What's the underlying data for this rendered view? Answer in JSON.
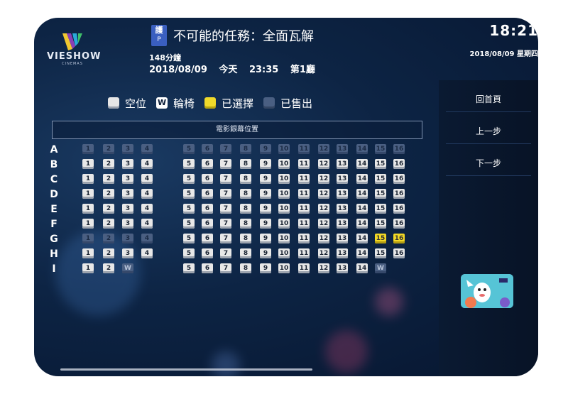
{
  "brand": {
    "name": "VIESHOW",
    "sub": "CINEMAS",
    "logo_icon": "vieshow-logo-icon"
  },
  "movie": {
    "rating_top": "護",
    "rating_bottom": "P",
    "title": "不可能的任務：全面瓦解",
    "runtime": "148分鐘",
    "date": "2018/08/09",
    "day": "今天",
    "time": "23:35",
    "hall": "第1廳"
  },
  "clock": {
    "time": "18:21",
    "date": "2018/08/09 星期四"
  },
  "legend": [
    {
      "label": "空位",
      "type": "empty"
    },
    {
      "label": "輪椅",
      "type": "wheel",
      "glyph": "W"
    },
    {
      "label": "已選擇",
      "type": "selected"
    },
    {
      "label": "已售出",
      "type": "sold"
    }
  ],
  "screen_label": "電影銀幕位置",
  "sidebar": {
    "home": "回首頁",
    "prev": "上一步",
    "next": "下一步"
  },
  "rows": [
    {
      "label": "A",
      "seats": [
        {
          "n": "1",
          "s": "sold"
        },
        {
          "n": "2",
          "s": "sold"
        },
        {
          "n": "3",
          "s": "sold"
        },
        {
          "n": "4",
          "s": "sold"
        },
        {
          "n": "5",
          "s": "sold"
        },
        {
          "n": "6",
          "s": "sold"
        },
        {
          "n": "7",
          "s": "sold"
        },
        {
          "n": "8",
          "s": "sold"
        },
        {
          "n": "9",
          "s": "sold"
        },
        {
          "n": "10",
          "s": "sold"
        },
        {
          "n": "11",
          "s": "sold"
        },
        {
          "n": "12",
          "s": "sold"
        },
        {
          "n": "13",
          "s": "sold"
        },
        {
          "n": "14",
          "s": "sold"
        },
        {
          "n": "15",
          "s": "sold"
        },
        {
          "n": "16",
          "s": "sold"
        }
      ]
    },
    {
      "label": "B",
      "seats": [
        {
          "n": "1",
          "s": "empty"
        },
        {
          "n": "2",
          "s": "empty"
        },
        {
          "n": "3",
          "s": "empty"
        },
        {
          "n": "4",
          "s": "empty"
        },
        {
          "n": "5",
          "s": "empty"
        },
        {
          "n": "6",
          "s": "empty"
        },
        {
          "n": "7",
          "s": "empty"
        },
        {
          "n": "8",
          "s": "empty"
        },
        {
          "n": "9",
          "s": "empty"
        },
        {
          "n": "10",
          "s": "empty"
        },
        {
          "n": "11",
          "s": "empty"
        },
        {
          "n": "12",
          "s": "empty"
        },
        {
          "n": "13",
          "s": "empty"
        },
        {
          "n": "14",
          "s": "empty"
        },
        {
          "n": "15",
          "s": "empty"
        },
        {
          "n": "16",
          "s": "empty"
        }
      ]
    },
    {
      "label": "C",
      "seats": [
        {
          "n": "1",
          "s": "empty"
        },
        {
          "n": "2",
          "s": "empty"
        },
        {
          "n": "3",
          "s": "empty"
        },
        {
          "n": "4",
          "s": "empty"
        },
        {
          "n": "5",
          "s": "empty"
        },
        {
          "n": "6",
          "s": "empty"
        },
        {
          "n": "7",
          "s": "empty"
        },
        {
          "n": "8",
          "s": "empty"
        },
        {
          "n": "9",
          "s": "empty"
        },
        {
          "n": "10",
          "s": "empty"
        },
        {
          "n": "11",
          "s": "empty"
        },
        {
          "n": "12",
          "s": "empty"
        },
        {
          "n": "13",
          "s": "empty"
        },
        {
          "n": "14",
          "s": "empty"
        },
        {
          "n": "15",
          "s": "empty"
        },
        {
          "n": "16",
          "s": "empty"
        }
      ]
    },
    {
      "label": "D",
      "seats": [
        {
          "n": "1",
          "s": "empty"
        },
        {
          "n": "2",
          "s": "empty"
        },
        {
          "n": "3",
          "s": "empty"
        },
        {
          "n": "4",
          "s": "empty"
        },
        {
          "n": "5",
          "s": "empty"
        },
        {
          "n": "6",
          "s": "empty"
        },
        {
          "n": "7",
          "s": "empty"
        },
        {
          "n": "8",
          "s": "empty"
        },
        {
          "n": "9",
          "s": "empty"
        },
        {
          "n": "10",
          "s": "empty"
        },
        {
          "n": "11",
          "s": "empty"
        },
        {
          "n": "12",
          "s": "empty"
        },
        {
          "n": "13",
          "s": "empty"
        },
        {
          "n": "14",
          "s": "empty"
        },
        {
          "n": "15",
          "s": "empty"
        },
        {
          "n": "16",
          "s": "empty"
        }
      ]
    },
    {
      "label": "E",
      "seats": [
        {
          "n": "1",
          "s": "empty"
        },
        {
          "n": "2",
          "s": "empty"
        },
        {
          "n": "3",
          "s": "empty"
        },
        {
          "n": "4",
          "s": "empty"
        },
        {
          "n": "5",
          "s": "empty"
        },
        {
          "n": "6",
          "s": "empty"
        },
        {
          "n": "7",
          "s": "empty"
        },
        {
          "n": "8",
          "s": "empty"
        },
        {
          "n": "9",
          "s": "empty"
        },
        {
          "n": "10",
          "s": "empty"
        },
        {
          "n": "11",
          "s": "empty"
        },
        {
          "n": "12",
          "s": "empty"
        },
        {
          "n": "13",
          "s": "empty"
        },
        {
          "n": "14",
          "s": "empty"
        },
        {
          "n": "15",
          "s": "empty"
        },
        {
          "n": "16",
          "s": "empty"
        }
      ]
    },
    {
      "label": "F",
      "seats": [
        {
          "n": "1",
          "s": "empty"
        },
        {
          "n": "2",
          "s": "empty"
        },
        {
          "n": "3",
          "s": "empty"
        },
        {
          "n": "4",
          "s": "empty"
        },
        {
          "n": "5",
          "s": "empty"
        },
        {
          "n": "6",
          "s": "empty"
        },
        {
          "n": "7",
          "s": "empty"
        },
        {
          "n": "8",
          "s": "empty"
        },
        {
          "n": "9",
          "s": "empty"
        },
        {
          "n": "10",
          "s": "empty"
        },
        {
          "n": "11",
          "s": "empty"
        },
        {
          "n": "12",
          "s": "empty"
        },
        {
          "n": "13",
          "s": "empty"
        },
        {
          "n": "14",
          "s": "empty"
        },
        {
          "n": "15",
          "s": "empty"
        },
        {
          "n": "16",
          "s": "empty"
        }
      ]
    },
    {
      "label": "G",
      "seats": [
        {
          "n": "1",
          "s": "sold"
        },
        {
          "n": "2",
          "s": "sold"
        },
        {
          "n": "3",
          "s": "sold"
        },
        {
          "n": "4",
          "s": "sold"
        },
        {
          "n": "5",
          "s": "empty"
        },
        {
          "n": "6",
          "s": "empty"
        },
        {
          "n": "7",
          "s": "empty"
        },
        {
          "n": "8",
          "s": "empty"
        },
        {
          "n": "9",
          "s": "empty"
        },
        {
          "n": "10",
          "s": "empty"
        },
        {
          "n": "11",
          "s": "empty"
        },
        {
          "n": "12",
          "s": "empty"
        },
        {
          "n": "13",
          "s": "empty"
        },
        {
          "n": "14",
          "s": "empty"
        },
        {
          "n": "15",
          "s": "selected"
        },
        {
          "n": "16",
          "s": "selected"
        }
      ]
    },
    {
      "label": "H",
      "seats": [
        {
          "n": "1",
          "s": "empty"
        },
        {
          "n": "2",
          "s": "empty"
        },
        {
          "n": "3",
          "s": "empty"
        },
        {
          "n": "4",
          "s": "empty"
        },
        {
          "n": "5",
          "s": "empty"
        },
        {
          "n": "6",
          "s": "empty"
        },
        {
          "n": "7",
          "s": "empty"
        },
        {
          "n": "8",
          "s": "empty"
        },
        {
          "n": "9",
          "s": "empty"
        },
        {
          "n": "10",
          "s": "empty"
        },
        {
          "n": "11",
          "s": "empty"
        },
        {
          "n": "12",
          "s": "empty"
        },
        {
          "n": "13",
          "s": "empty"
        },
        {
          "n": "14",
          "s": "empty"
        },
        {
          "n": "15",
          "s": "empty"
        },
        {
          "n": "16",
          "s": "empty"
        }
      ]
    },
    {
      "label": "I",
      "seats": [
        {
          "n": "1",
          "s": "empty"
        },
        {
          "n": "2",
          "s": "empty"
        },
        {
          "n": "W",
          "s": "wheel"
        },
        null,
        {
          "n": "5",
          "s": "empty"
        },
        {
          "n": "6",
          "s": "empty"
        },
        {
          "n": "7",
          "s": "empty"
        },
        {
          "n": "8",
          "s": "empty"
        },
        {
          "n": "9",
          "s": "empty"
        },
        {
          "n": "10",
          "s": "empty"
        },
        {
          "n": "11",
          "s": "empty"
        },
        {
          "n": "12",
          "s": "empty"
        },
        {
          "n": "13",
          "s": "empty"
        },
        {
          "n": "14",
          "s": "empty"
        },
        {
          "n": "W",
          "s": "wheel"
        },
        null
      ]
    }
  ],
  "colors": {
    "selected": "#f2d825",
    "sold": "#4a5f82",
    "empty": "#e8e8e8",
    "background": "#0d2444"
  }
}
